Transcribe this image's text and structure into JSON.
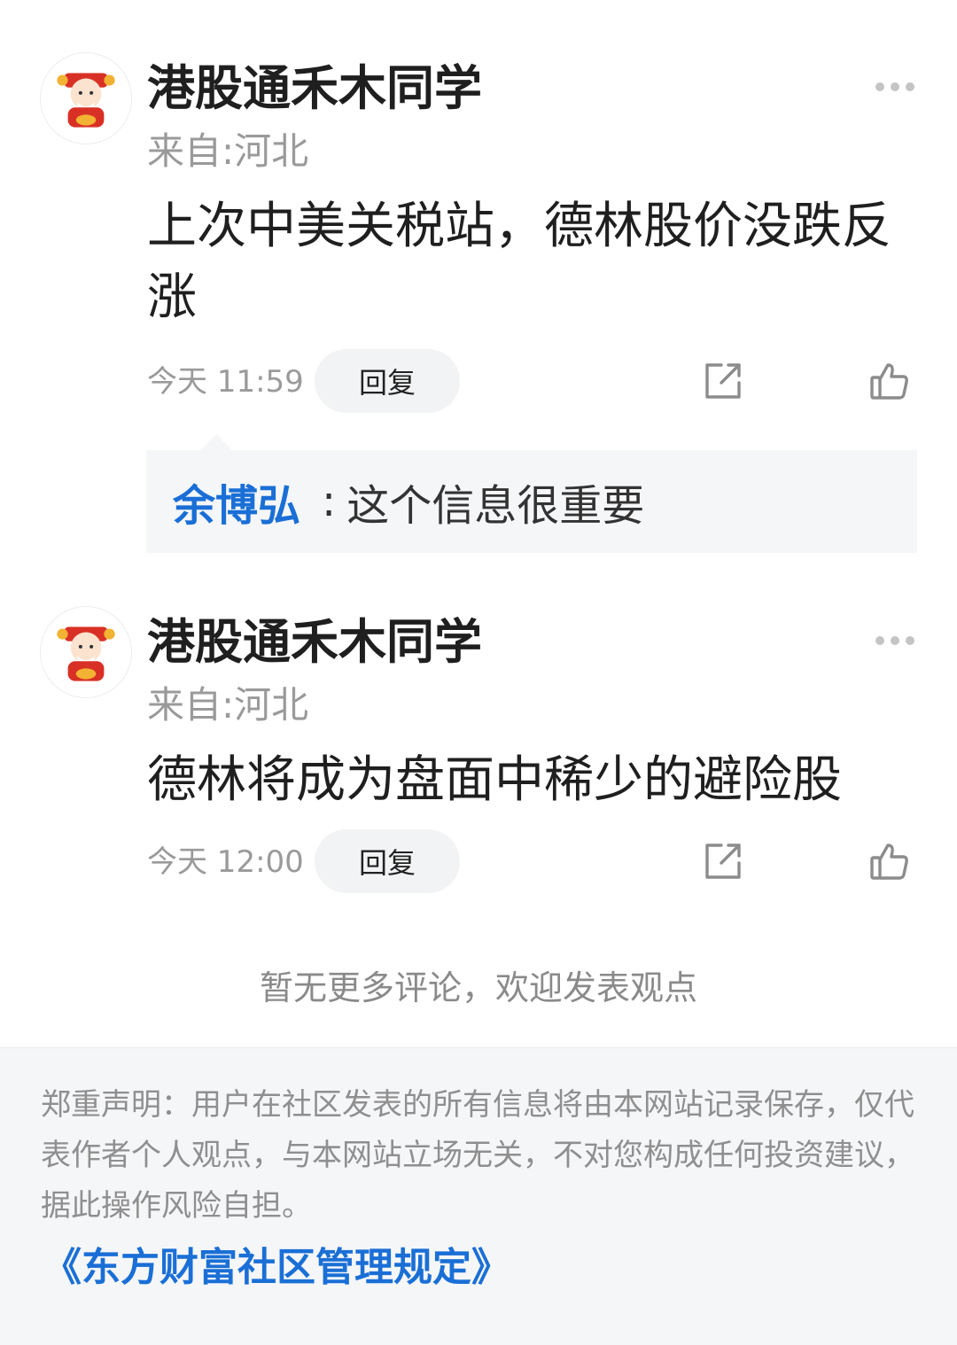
{
  "comments": [
    {
      "username": "港股通禾木同学",
      "location": "来自:河北",
      "content": "上次中美关税站，德林股价没跌反涨",
      "time": "今天 11:59",
      "reply_label": "回复",
      "replies": [
        {
          "name": "余博弘",
          "separator": ":",
          "text": "这个信息很重要"
        }
      ]
    },
    {
      "username": "港股通禾木同学",
      "location": "来自:河北",
      "content": "德林将成为盘面中稀少的避险股",
      "time": "今天 12:00",
      "reply_label": "回复",
      "replies": []
    }
  ],
  "icons": {
    "more": "more-dots-icon",
    "share": "share-icon",
    "like": "thumbs-up-icon",
    "avatar": "avatar-caishen"
  },
  "no_more_text": "暂无更多评论，欢迎发表观点",
  "footer": {
    "disclaimer": "郑重声明：用户在社区发表的所有信息将由本网站记录保存，仅代表作者个人观点，与本网站立场无关，不对您构成任何投资建议，据此操作风险自担。",
    "rules_link": "《东方财富社区管理规定》"
  },
  "colors": {
    "link_blue": "#1a6fd6",
    "muted_gray": "#9a9a9a",
    "panel_bg": "#f5f6f8"
  }
}
